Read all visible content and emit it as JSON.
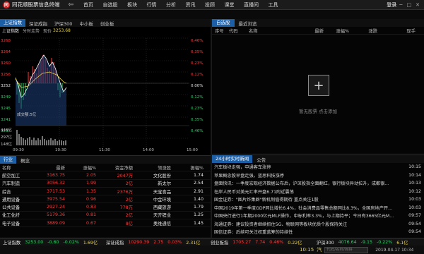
{
  "app": {
    "logo": "同",
    "title": "同花顺股票信息终端",
    "back": "⇦",
    "login": "登录",
    "win_min": "─",
    "win_max": "□",
    "win_close": "✕"
  },
  "menu": [
    "首页",
    "自选股",
    "板块",
    "行情",
    "分析",
    "资讯",
    "投顾",
    "课堂",
    "直播间",
    "工具"
  ],
  "left_tabs": [
    "上证指数",
    "深证成指",
    "沪深300",
    "中小板",
    "创业板"
  ],
  "chart": {
    "legend_prefix": "上证指数",
    "legend_mid": "分时走势",
    "legend_price_label": "现价",
    "price": "3253.68",
    "y_left": [
      "3268",
      "3264",
      "3260",
      "3256",
      "3252",
      "3249",
      "3245",
      "3241",
      "3237"
    ],
    "y_right_pct": [
      "0.46%",
      "0.35%",
      "0.23%",
      "0.12%",
      "0.00%",
      "0.12%",
      "0.23%",
      "0.35%",
      "0.46%"
    ],
    "vol_label": "成交额:5亿",
    "vol_ticks": [
      "446亿",
      "297亿",
      "148亿"
    ],
    "x_ticks": [
      "09:30",
      "10:30",
      "11:30",
      "14:00",
      "15:00"
    ]
  },
  "sector": {
    "tabs": [
      "行业",
      "概念"
    ],
    "headers": [
      "名称",
      "最新",
      "涨幅%",
      "资金净额",
      "领涨股",
      "振幅%"
    ],
    "rows": [
      {
        "name": "航空加工",
        "last": "3163.75",
        "chg": "2.05",
        "net": "2047万",
        "lead": "文化股份",
        "amp": "1.74"
      },
      {
        "name": "汽车制造",
        "last": "3056.32",
        "chg": "1.99",
        "net": "2亿",
        "lead": "新太尔",
        "amp": "2.54"
      },
      {
        "name": "综合",
        "last": "3717.53",
        "chg": "1.35",
        "net": "2376万",
        "lead": "天宝食品",
        "amp": "2.91"
      },
      {
        "name": "通用设备",
        "last": "3975.54",
        "chg": "0.96",
        "net": "2亿",
        "lead": "中金环境",
        "amp": "1.40"
      },
      {
        "name": "公共设备",
        "last": "2927.24",
        "chg": "0.83",
        "net": "778万",
        "lead": "西藏旅游",
        "amp": "1.79"
      },
      {
        "name": "化工化纤",
        "last": "5179.36",
        "chg": "0.81",
        "net": "2亿",
        "lead": "天齐锂业",
        "amp": "1.25"
      },
      {
        "name": "电子设备",
        "last": "3889.09",
        "chg": "0.67",
        "net": "8亿",
        "lead": "奥维通信",
        "amp": "1.45"
      }
    ]
  },
  "watch": {
    "tabs": [
      "自选股",
      "最近浏览"
    ],
    "headers": [
      "序号",
      "代码",
      "名称",
      "最新",
      "涨幅%",
      "涨跌",
      "现手"
    ],
    "plus": "+",
    "empty": "暂无股票 点击添加"
  },
  "news": {
    "tabs": [
      "24小时实时新闻",
      "公告"
    ],
    "items": [
      {
        "title": "汽车板块走强，中通客车涨停",
        "time": "10:15"
      },
      {
        "title": "苹果概念股早盘走强，蓝思科技涨停",
        "time": "10:14"
      },
      {
        "title": "盘面快讯：一季度宏观经济数据公布后，沪深股指全面翻红，银行板块异动拉升，成都银...",
        "time": "10:13"
      },
      {
        "title": "在岸人民币对美元汇率开盘6.71附近震荡",
        "time": "10:12"
      },
      {
        "title": "国金证券：\"图片炸集群\"新机制值得期待 重点关注1股",
        "time": "10:03"
      },
      {
        "title": "中国2019年第一季度GDP同比增长6.4%，社会消费品零售总额同比8.3%，全国房地产开...",
        "time": "10:03"
      },
      {
        "title": "中国央行进行1年期2000亿元MLF操作，中标利率3.3%，与上期持平；今日有3665亿元M...",
        "time": "09:57"
      },
      {
        "title": "海通证券：建议投资者继续抓住5G、物联网等板块优质个股保持关注",
        "time": "09:54"
      },
      {
        "title": "国信证券：后续可关注权重蓝筹的持续性",
        "time": "09:54"
      }
    ]
  },
  "status": [
    {
      "label": "上证指数",
      "val": "3253.00",
      "chg": "-0.60",
      "pct": "-0.02%",
      "amt": "1.69亿"
    },
    {
      "label": "深证成指",
      "val": "10290.39",
      "chg": "2.75",
      "pct": "0.03%",
      "amt": "2.31亿"
    },
    {
      "label": "创业板指",
      "val": "1705.27",
      "chg": "7.74",
      "pct": "0.46%",
      "amt": "0.22亿"
    },
    {
      "label": "沪深300",
      "val": "4076.64",
      "chg": "-9.15",
      "pct": "-0.22%",
      "amt": "6.1亿"
    }
  ],
  "bottom": {
    "time": "10:15",
    "search_placeholder": "代码/名称/简拼",
    "date": "2019-04-17 10:34",
    "fund": "汽"
  },
  "colors": {
    "blue": "#1d5fa6",
    "red": "#ff3b3b",
    "green": "#29d36a",
    "yellow": "#e8d24a"
  }
}
